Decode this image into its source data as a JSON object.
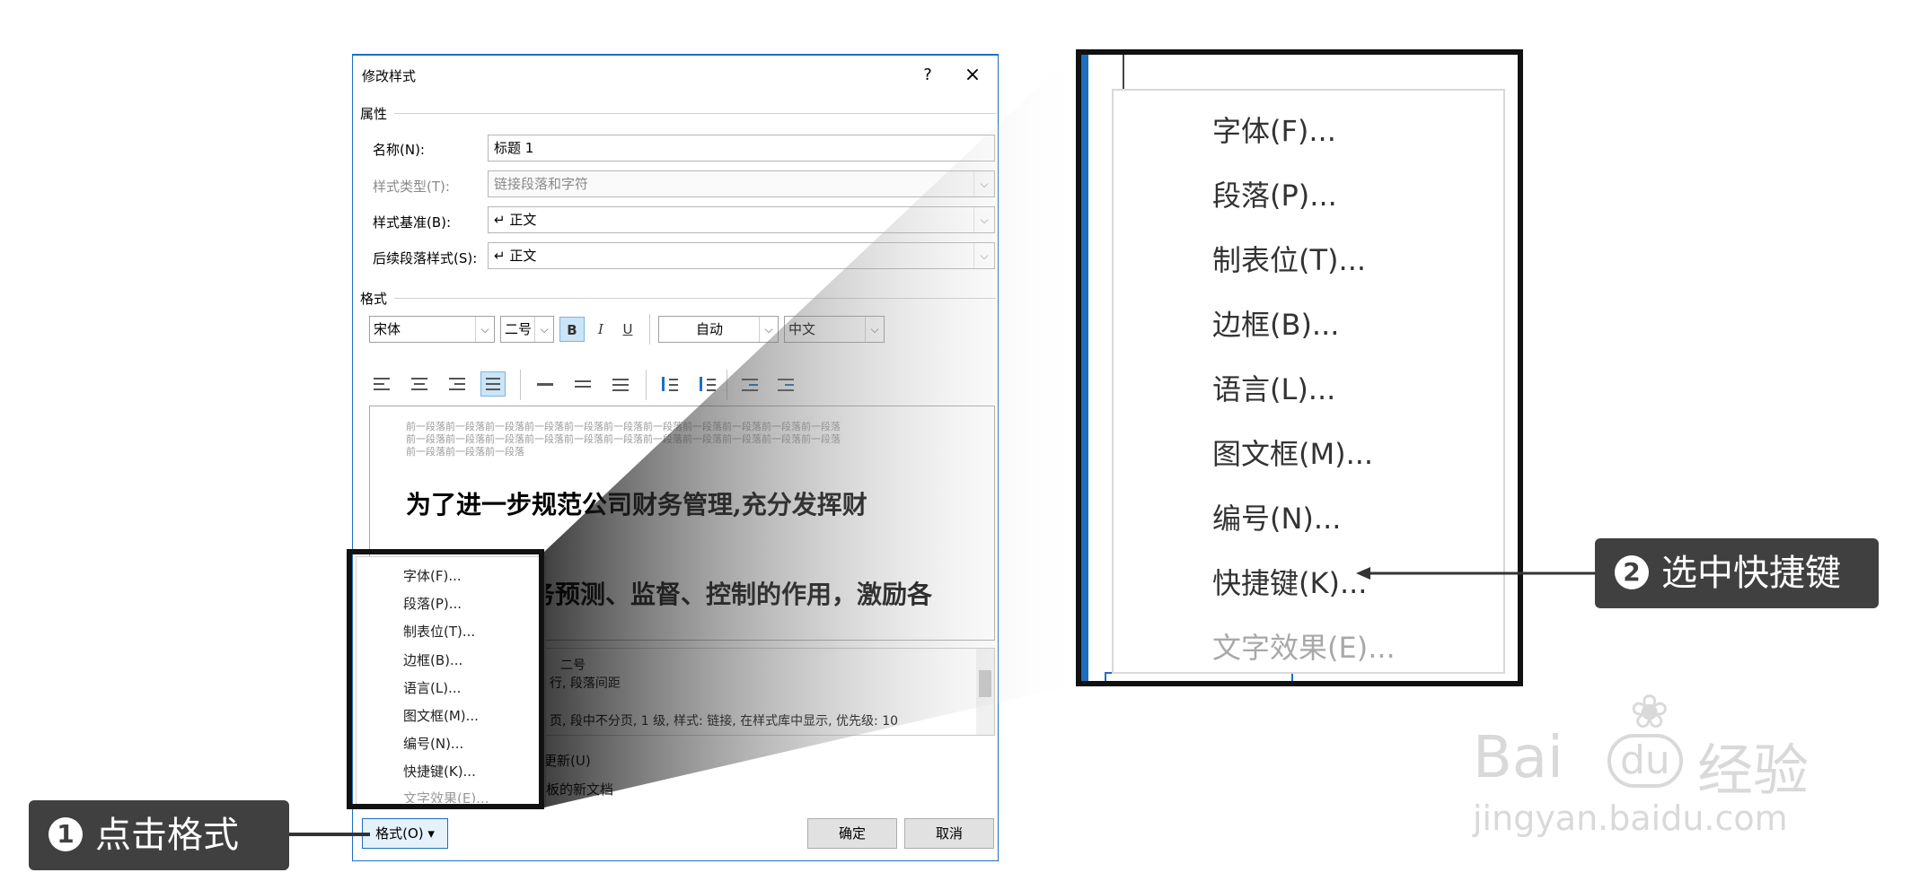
{
  "dialog": {
    "title": "修改样式",
    "help": "?",
    "close": "×",
    "properties": {
      "section": "属性",
      "name_label": "名称(N):",
      "name_value": "标题 1",
      "type_label": "样式类型(T):",
      "type_value": "链接段落和字符",
      "based_label": "样式基准(B):",
      "based_value": "↵ 正文",
      "next_label": "后续段落样式(S):",
      "next_value": "↵ 正文"
    },
    "format": {
      "section": "格式",
      "font": "宋体",
      "size": "二号",
      "bold": "B",
      "italic": "I",
      "underline": "U",
      "color": "自动",
      "lang": "中文"
    },
    "preview": {
      "prev_para_1": "前一段落前一段落前一段落前一段落前一段落前一段落前一段落前一段落前一段落前一段落前一段落",
      "prev_para_2": "前一段落前一段落前一段落前一段落前一段落前一段落前一段落前一段落前一段落前一段落前一段落",
      "prev_para_3": "前一段落前一段落前一段落",
      "line1": "为了进一步规范公司财务管理,充分发挥财",
      "line2": "务预测、监督、控制的作用，激励各"
    },
    "description": {
      "line1": "二号",
      "line2": "行, 段落间距",
      "line3": "页, 段中不分页, 1 级, 样式: 链接, 在样式库中显示, 优先级: 10"
    },
    "options": {
      "auto_update": "更新(U)",
      "new_docs": "模板的新文档"
    },
    "buttons": {
      "format": "格式(O) ▾",
      "ok": "确定",
      "cancel": "取消"
    }
  },
  "format_menu": {
    "items": [
      "字体(F)...",
      "段落(P)...",
      "制表位(T)...",
      "边框(B)...",
      "语言(L)...",
      "图文框(M)...",
      "编号(N)...",
      "快捷键(K)...",
      "文字效果(E)..."
    ],
    "disabled_index": 8
  },
  "callouts": {
    "step1_num": "1",
    "step1_text": "点击格式",
    "step2_num": "2",
    "step2_text": "选中快捷键"
  },
  "watermark": {
    "brand_a": "Bai",
    "brand_b": "du",
    "brand_c": "经验",
    "url": "jingyan.baidu.com"
  },
  "colors": {
    "accent": "#1e6fc0",
    "callout_bg": "#404040",
    "highlight_border": "#111111"
  }
}
